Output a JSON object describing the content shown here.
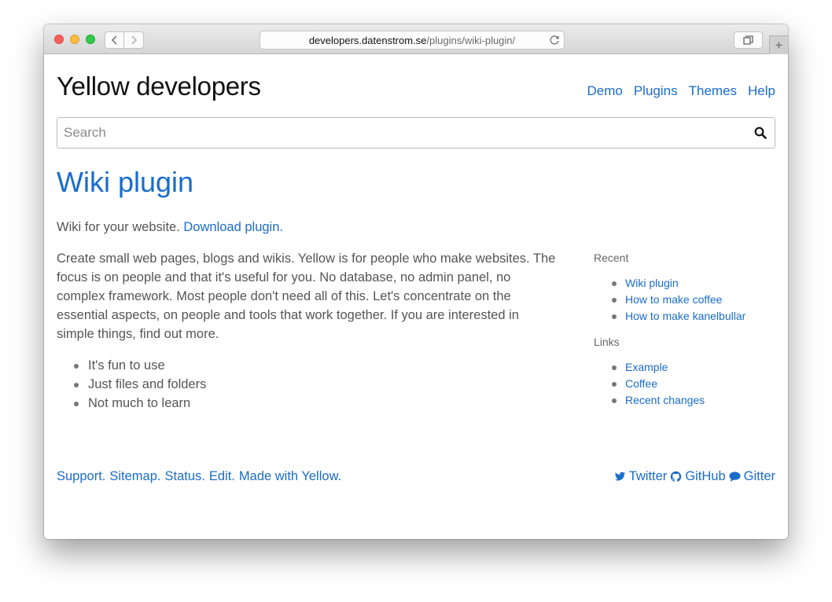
{
  "browser": {
    "url_host": "developers.datenstrom.se",
    "url_path": "/plugins/wiki-plugin/",
    "new_tab_label": "+"
  },
  "site": {
    "title": "Yellow developers",
    "nav": [
      "Demo",
      "Plugins",
      "Themes",
      "Help"
    ]
  },
  "search": {
    "placeholder": "Search",
    "value": ""
  },
  "page": {
    "title": "Wiki plugin",
    "intro_text": "Wiki for your website.",
    "intro_link": "Download plugin.",
    "paragraph": "Create small web pages, blogs and wikis. Yellow is for people who make websites. The focus is on people and that it's useful for you. No database, no admin panel, no complex framework. Most people don't need all of this. Let's concentrate on the essential aspects, on people and tools that work together. If you are interested in simple things, find out more.",
    "bullets": [
      "It's fun to use",
      "Just files and folders",
      "Not much to learn"
    ]
  },
  "sidebar": {
    "recent_heading": "Recent",
    "recent": [
      "Wiki plugin",
      "How to make coffee",
      "How to make kanelbullar"
    ],
    "links_heading": "Links",
    "links": [
      "Example",
      "Coffee",
      "Recent changes"
    ]
  },
  "footer": {
    "left_links": [
      "Support.",
      "Sitemap.",
      "Status.",
      "Edit.",
      "Made with Yellow."
    ],
    "social": [
      {
        "label": "Twitter",
        "icon": "twitter-icon"
      },
      {
        "label": "GitHub",
        "icon": "github-icon"
      },
      {
        "label": "Gitter",
        "icon": "gitter-icon"
      }
    ]
  },
  "colors": {
    "link": "#1a6ccb",
    "text": "#555555",
    "title": "#111111"
  }
}
